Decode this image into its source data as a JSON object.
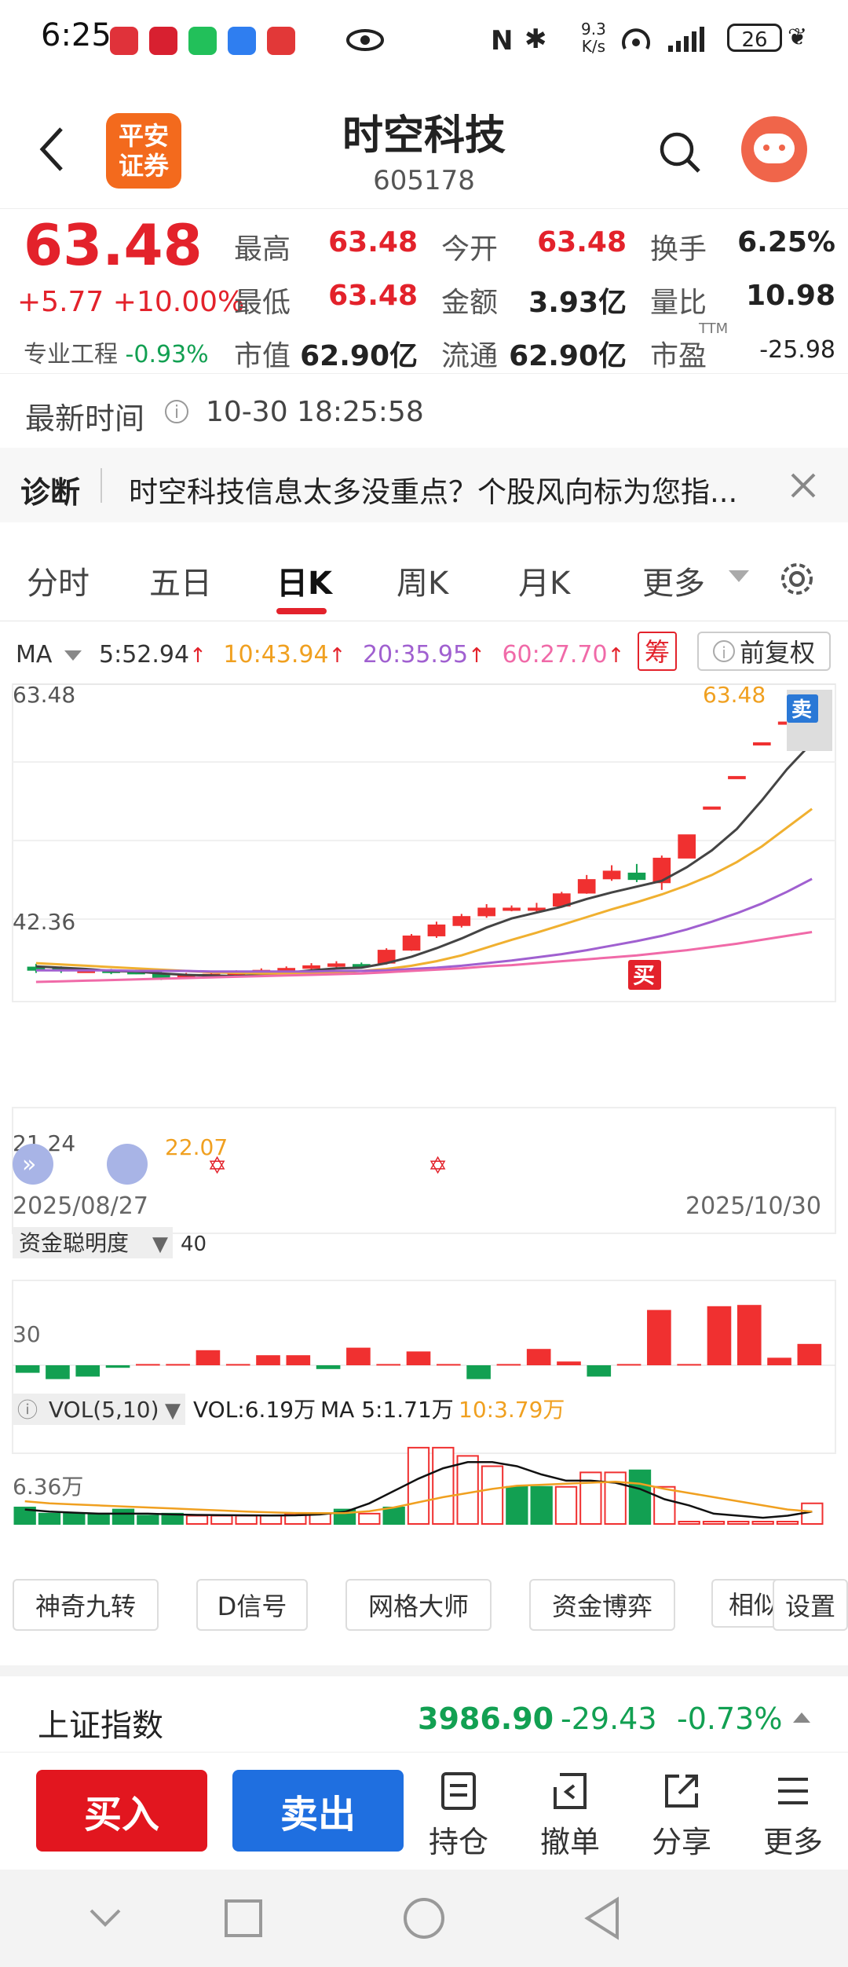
{
  "status": {
    "time": "6:25",
    "net_speed_top": "9.3",
    "net_speed_bottom": "K/s",
    "battery": "26"
  },
  "header": {
    "logo_line1": "平安",
    "logo_line2": "证券",
    "title": "时空科技",
    "code": "605178"
  },
  "quote": {
    "price": "63.48",
    "change": "+5.77",
    "change_pct": "+10.00%",
    "sector_name": "专业工程",
    "sector_pct": "-0.93%",
    "fields": [
      {
        "label": "最高",
        "value": "63.48"
      },
      {
        "label": "今开",
        "value": "63.48"
      },
      {
        "label": "换手",
        "value": "6.25%"
      },
      {
        "label": "最低",
        "value": "63.48"
      },
      {
        "label": "金额",
        "value": "3.93亿"
      },
      {
        "label": "量比",
        "value": "10.98"
      },
      {
        "label": "市值",
        "value": "62.90亿"
      },
      {
        "label": "流通",
        "value": "62.90亿"
      },
      {
        "label": "市盈",
        "value": "-25.98"
      }
    ],
    "pe_suffix": "TTM"
  },
  "timebar": {
    "label": "最新时间",
    "value": "10-30 18:25:58"
  },
  "diagnosis": {
    "label": "诊断",
    "text": "时空科技信息太多没重点？个股风向标为您指..."
  },
  "tabs": [
    "分时",
    "五日",
    "日K",
    "周K",
    "月K",
    "更多"
  ],
  "active_tab": "日K",
  "ma": {
    "label": "MA",
    "items": [
      {
        "text": "5:52.94",
        "color": "#333333"
      },
      {
        "text": "10:43.94",
        "color": "#f0a020"
      },
      {
        "text": "20:35.95",
        "color": "#a060d0"
      },
      {
        "text": "60:27.70",
        "color": "#f06aa8"
      }
    ],
    "chip_label": "筹",
    "adjust_label": "前复权"
  },
  "chart_labels": {
    "y_top": "63.48",
    "y_mid": "42.36",
    "y_low": "21.24",
    "high_marker": "63.48",
    "low_marker": "22.07",
    "sell_tag": "卖",
    "buy_tag": "买",
    "date_start": "2025/08/27",
    "date_end": "2025/10/30"
  },
  "fund_panel": {
    "label": "资金聪明度",
    "value": "40",
    "y_label": "30"
  },
  "vol_panel": {
    "label": "VOL(5,10)",
    "vol_text": "VOL:6.19万",
    "ma5_text": "MA 5:1.71万",
    "ma10_text": "10:3.79万",
    "y_label": "6.36万"
  },
  "tools": [
    "神奇九转",
    "D信号",
    "网格大师",
    "资金博弈",
    "相似",
    "设置"
  ],
  "index": {
    "name": "上证指数",
    "value": "3986.90",
    "change": "-29.43",
    "pct": "-0.73%"
  },
  "actions": {
    "buy": "买入",
    "sell": "卖出",
    "hold": "持仓",
    "cancel": "撤单",
    "share": "分享",
    "more": "更多"
  },
  "chart_data": {
    "type": "candlestick",
    "title": "",
    "x_start": "2025/08/27",
    "x_end": "2025/10/30",
    "ylim": [
      21.24,
      63.48
    ],
    "candles": [
      {
        "o": 22.4,
        "c": 21.9,
        "h": 22.9,
        "l": 21.5
      },
      {
        "o": 22.2,
        "c": 21.8,
        "h": 22.5,
        "l": 21.5
      },
      {
        "o": 21.9,
        "c": 21.9,
        "h": 22.2,
        "l": 21.6
      },
      {
        "o": 21.9,
        "c": 21.6,
        "h": 22.1,
        "l": 21.3
      },
      {
        "o": 21.7,
        "c": 21.5,
        "h": 22.0,
        "l": 21.3
      },
      {
        "o": 21.4,
        "c": 20.6,
        "h": 21.7,
        "l": 20.4
      },
      {
        "o": 20.8,
        "c": 21.2,
        "h": 21.5,
        "l": 20.6
      },
      {
        "o": 21.1,
        "c": 21.3,
        "h": 21.6,
        "l": 20.9
      },
      {
        "o": 21.3,
        "c": 21.6,
        "h": 21.9,
        "l": 21.1
      },
      {
        "o": 21.6,
        "c": 21.9,
        "h": 22.2,
        "l": 21.4
      },
      {
        "o": 21.9,
        "c": 22.2,
        "h": 22.5,
        "l": 21.7
      },
      {
        "o": 22.2,
        "c": 22.6,
        "h": 23.0,
        "l": 22.0
      },
      {
        "o": 22.5,
        "c": 22.9,
        "h": 23.3,
        "l": 22.3
      },
      {
        "o": 22.8,
        "c": 22.6,
        "h": 23.1,
        "l": 22.3
      },
      {
        "o": 23.0,
        "c": 25.0,
        "h": 25.3,
        "l": 22.8
      },
      {
        "o": 25.0,
        "c": 27.2,
        "h": 27.5,
        "l": 24.9
      },
      {
        "o": 27.2,
        "c": 28.9,
        "h": 29.4,
        "l": 26.9
      },
      {
        "o": 28.8,
        "c": 30.2,
        "h": 30.6,
        "l": 28.5
      },
      {
        "o": 30.3,
        "c": 31.5,
        "h": 32.1,
        "l": 30.0
      },
      {
        "o": 31.4,
        "c": 31.5,
        "h": 31.9,
        "l": 31.0
      },
      {
        "o": 31.4,
        "c": 31.5,
        "h": 32.3,
        "l": 30.7
      },
      {
        "o": 31.8,
        "c": 33.7,
        "h": 34.0,
        "l": 31.6
      },
      {
        "o": 33.8,
        "c": 35.9,
        "h": 36.6,
        "l": 33.7
      },
      {
        "o": 36.0,
        "c": 37.2,
        "h": 38.1,
        "l": 35.7
      },
      {
        "o": 36.9,
        "c": 35.9,
        "h": 38.3,
        "l": 35.5
      },
      {
        "o": 35.4,
        "c": 39.2,
        "h": 39.6,
        "l": 34.3
      },
      {
        "o": 39.2,
        "c": 42.8,
        "h": 42.8,
        "l": 42.8
      },
      {
        "o": 47.1,
        "c": 47.1,
        "h": 47.1,
        "l": 47.1
      },
      {
        "o": 51.8,
        "c": 51.8,
        "h": 51.8,
        "l": 51.8
      },
      {
        "o": 57.0,
        "c": 57.0,
        "h": 57.0,
        "l": 57.0
      },
      {
        "o": 60.2,
        "c": 60.2,
        "h": 60.2,
        "l": 60.2
      },
      {
        "o": 63.48,
        "c": 63.48,
        "h": 63.48,
        "l": 63.48
      }
    ],
    "ma5": [
      22.5,
      22.3,
      22.1,
      21.8,
      21.7,
      21.4,
      21.2,
      21.1,
      21.0,
      21.2,
      21.5,
      21.9,
      22.2,
      22.3,
      23.0,
      24.0,
      25.3,
      26.8,
      28.5,
      29.9,
      30.8,
      31.7,
      32.9,
      33.9,
      34.8,
      35.7,
      37.8,
      40.4,
      43.7,
      48.1,
      52.9,
      57.0
    ],
    "ma10": [
      23.0,
      22.8,
      22.6,
      22.4,
      22.2,
      22.0,
      21.8,
      21.6,
      21.5,
      21.4,
      21.4,
      21.5,
      21.6,
      21.8,
      22.1,
      22.6,
      23.3,
      24.2,
      25.4,
      26.6,
      27.7,
      28.9,
      30.1,
      31.3,
      32.4,
      33.6,
      35.0,
      36.6,
      38.6,
      41.0,
      43.9,
      46.8
    ],
    "ma20": [
      21.9,
      21.9,
      21.9,
      21.9,
      21.8,
      21.8,
      21.8,
      21.7,
      21.7,
      21.7,
      21.7,
      21.7,
      21.8,
      21.8,
      21.9,
      22.1,
      22.3,
      22.6,
      23.0,
      23.4,
      23.9,
      24.4,
      25.0,
      25.7,
      26.4,
      27.2,
      28.2,
      29.4,
      30.7,
      32.2,
      34.0,
      36.0
    ],
    "ma60": [
      20.1,
      20.2,
      20.3,
      20.4,
      20.5,
      20.6,
      20.7,
      20.8,
      20.9,
      21.0,
      21.1,
      21.2,
      21.3,
      21.4,
      21.6,
      21.8,
      22.0,
      22.2,
      22.5,
      22.7,
      23.0,
      23.3,
      23.6,
      23.9,
      24.2,
      24.6,
      25.0,
      25.5,
      26.0,
      26.6,
      27.2,
      27.8
    ],
    "fund": [
      -6,
      -11,
      -9,
      -2,
      1,
      1,
      12,
      1,
      8,
      8,
      -3,
      14,
      1,
      11,
      1,
      -11,
      1,
      13,
      3,
      -9,
      1,
      44,
      1,
      47,
      48,
      6,
      17
    ],
    "volume": [
      8,
      5,
      5,
      5,
      7,
      4,
      5,
      4,
      4,
      4,
      4,
      5,
      5,
      7,
      5,
      8,
      37,
      37,
      33,
      28,
      18,
      18,
      18,
      25,
      25,
      26,
      18,
      1,
      1,
      1,
      1,
      1,
      10
    ],
    "volume_up": [
      false,
      false,
      false,
      false,
      false,
      false,
      false,
      true,
      true,
      true,
      true,
      true,
      true,
      false,
      true,
      false,
      true,
      true,
      true,
      true,
      false,
      false,
      true,
      true,
      true,
      false,
      true,
      true,
      true,
      true,
      true,
      true,
      true
    ],
    "vol_ma5": [
      7,
      6,
      5.5,
      5,
      5,
      5,
      4.6,
      4.4,
      4.3,
      4.2,
      4.1,
      4.2,
      4.6,
      5.8,
      10,
      16,
      22,
      27,
      30,
      30,
      28,
      24,
      21,
      21,
      20,
      17,
      12,
      9,
      5,
      4,
      3,
      4,
      6
    ],
    "vol_ma10": [
      11,
      10,
      9.5,
      9,
      8.5,
      8,
      7.5,
      7,
      6.5,
      6,
      5.6,
      5.3,
      5.2,
      5.3,
      6.2,
      8,
      10.5,
      13,
      15,
      17,
      18.5,
      19,
      19.5,
      20,
      20.5,
      19.5,
      17,
      15,
      13,
      11,
      9,
      7,
      6
    ]
  }
}
